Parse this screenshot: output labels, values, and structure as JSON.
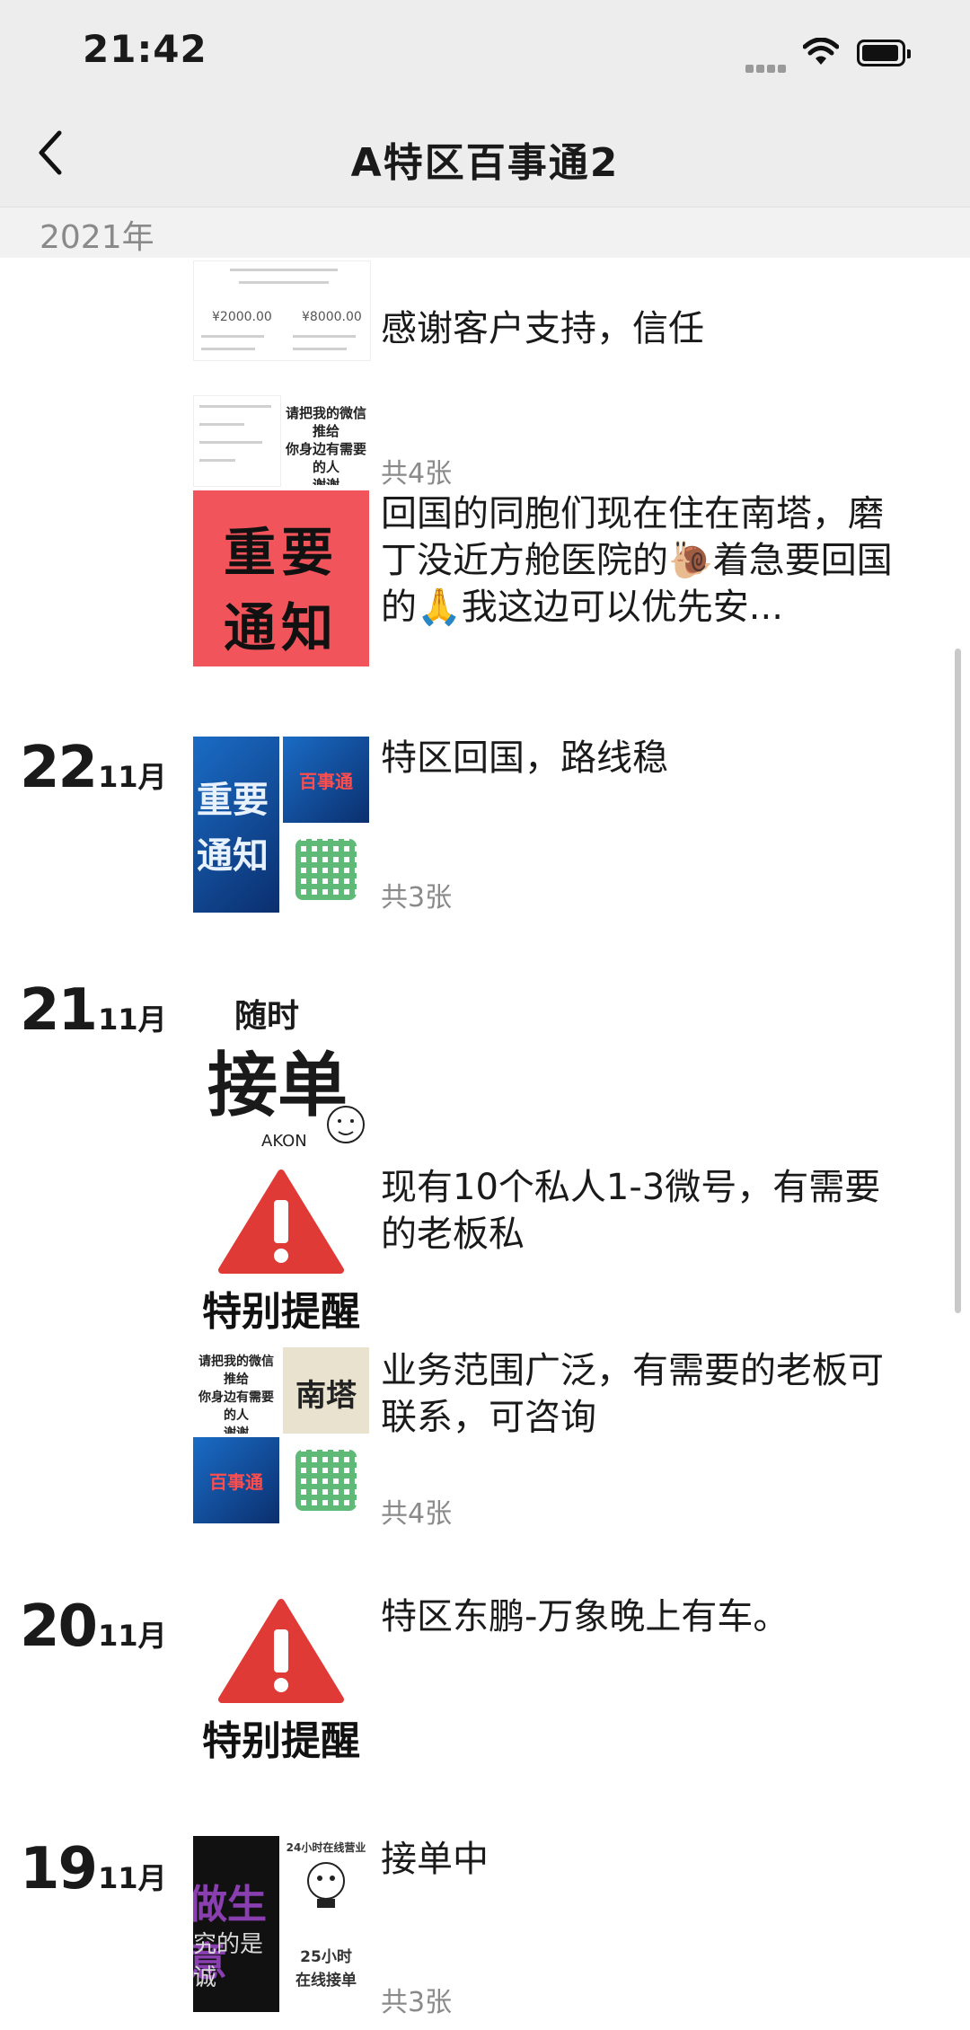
{
  "status_bar": {
    "time": "21:42"
  },
  "nav": {
    "title": "A特区百事通2"
  },
  "timeline": {
    "year": "2021年"
  },
  "entries": {
    "e0": {
      "caption": "感谢客户支持，信任",
      "price1": "¥2000.00",
      "price2": "¥8000.00"
    },
    "e1": {
      "caption": "",
      "count": "共4张",
      "wechat_text": "请把我的微信\n推给\n你身边有需要的人\n谢谢"
    },
    "e2": {
      "caption": "回国的同胞们现在住在南塔，磨丁没近方舱医院的🐌着急要回国的🙏我这边可以优先安...",
      "tile_line1": "重要",
      "tile_line2": "通知"
    },
    "e3": {
      "day": "22",
      "month": "11月",
      "caption": "特区回国，路线稳",
      "count": "共3张",
      "tile_a": "重要\n通知",
      "tile_b": "百事通"
    },
    "e4": {
      "day": "21",
      "month": "11月",
      "tile_top": "随时",
      "tile_main": "接单",
      "tile_sig": "AKON"
    },
    "e5": {
      "caption": "现有10个私人1-3微号，有需要的老板私",
      "warn": "特别提醒"
    },
    "e6": {
      "caption": "业务范围广泛，有需要的老板可联系，可咨询",
      "count": "共4张",
      "tile_b": "南塔",
      "tile_c": "百事通"
    },
    "e7": {
      "day": "20",
      "month": "11月",
      "caption": "特区东鹏-万象晚上有车。",
      "warn": "特别提醒"
    },
    "e8": {
      "day": "19",
      "month": "11月",
      "caption": "接单中",
      "count": "共3张",
      "tile_a1": "做生意",
      "tile_a2": "究的是诚",
      "tile_b": "24小时在线营业",
      "tile_c": "25小时\n在线接单"
    }
  },
  "colors": {
    "notice_red": "#f1545a",
    "warning_red": "#e03a36",
    "muted_text": "#8a8a8a",
    "chrome_bg": "#ededed"
  }
}
